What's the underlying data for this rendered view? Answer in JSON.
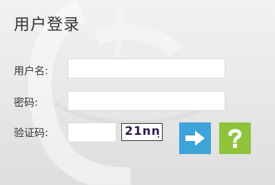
{
  "login": {
    "title": "用户登录",
    "username_label": "用户名:",
    "username_value": "",
    "password_label": "密码:",
    "password_value": "",
    "captcha_label": "验证码:",
    "captcha_value": "",
    "captcha_image_text": "21nn"
  },
  "buttons": {
    "submit_icon": "arrow-right-icon",
    "help_icon": "question-mark-icon"
  },
  "colors": {
    "submit_bg": "#3ea3d9",
    "help_bg": "#8fc33a"
  }
}
